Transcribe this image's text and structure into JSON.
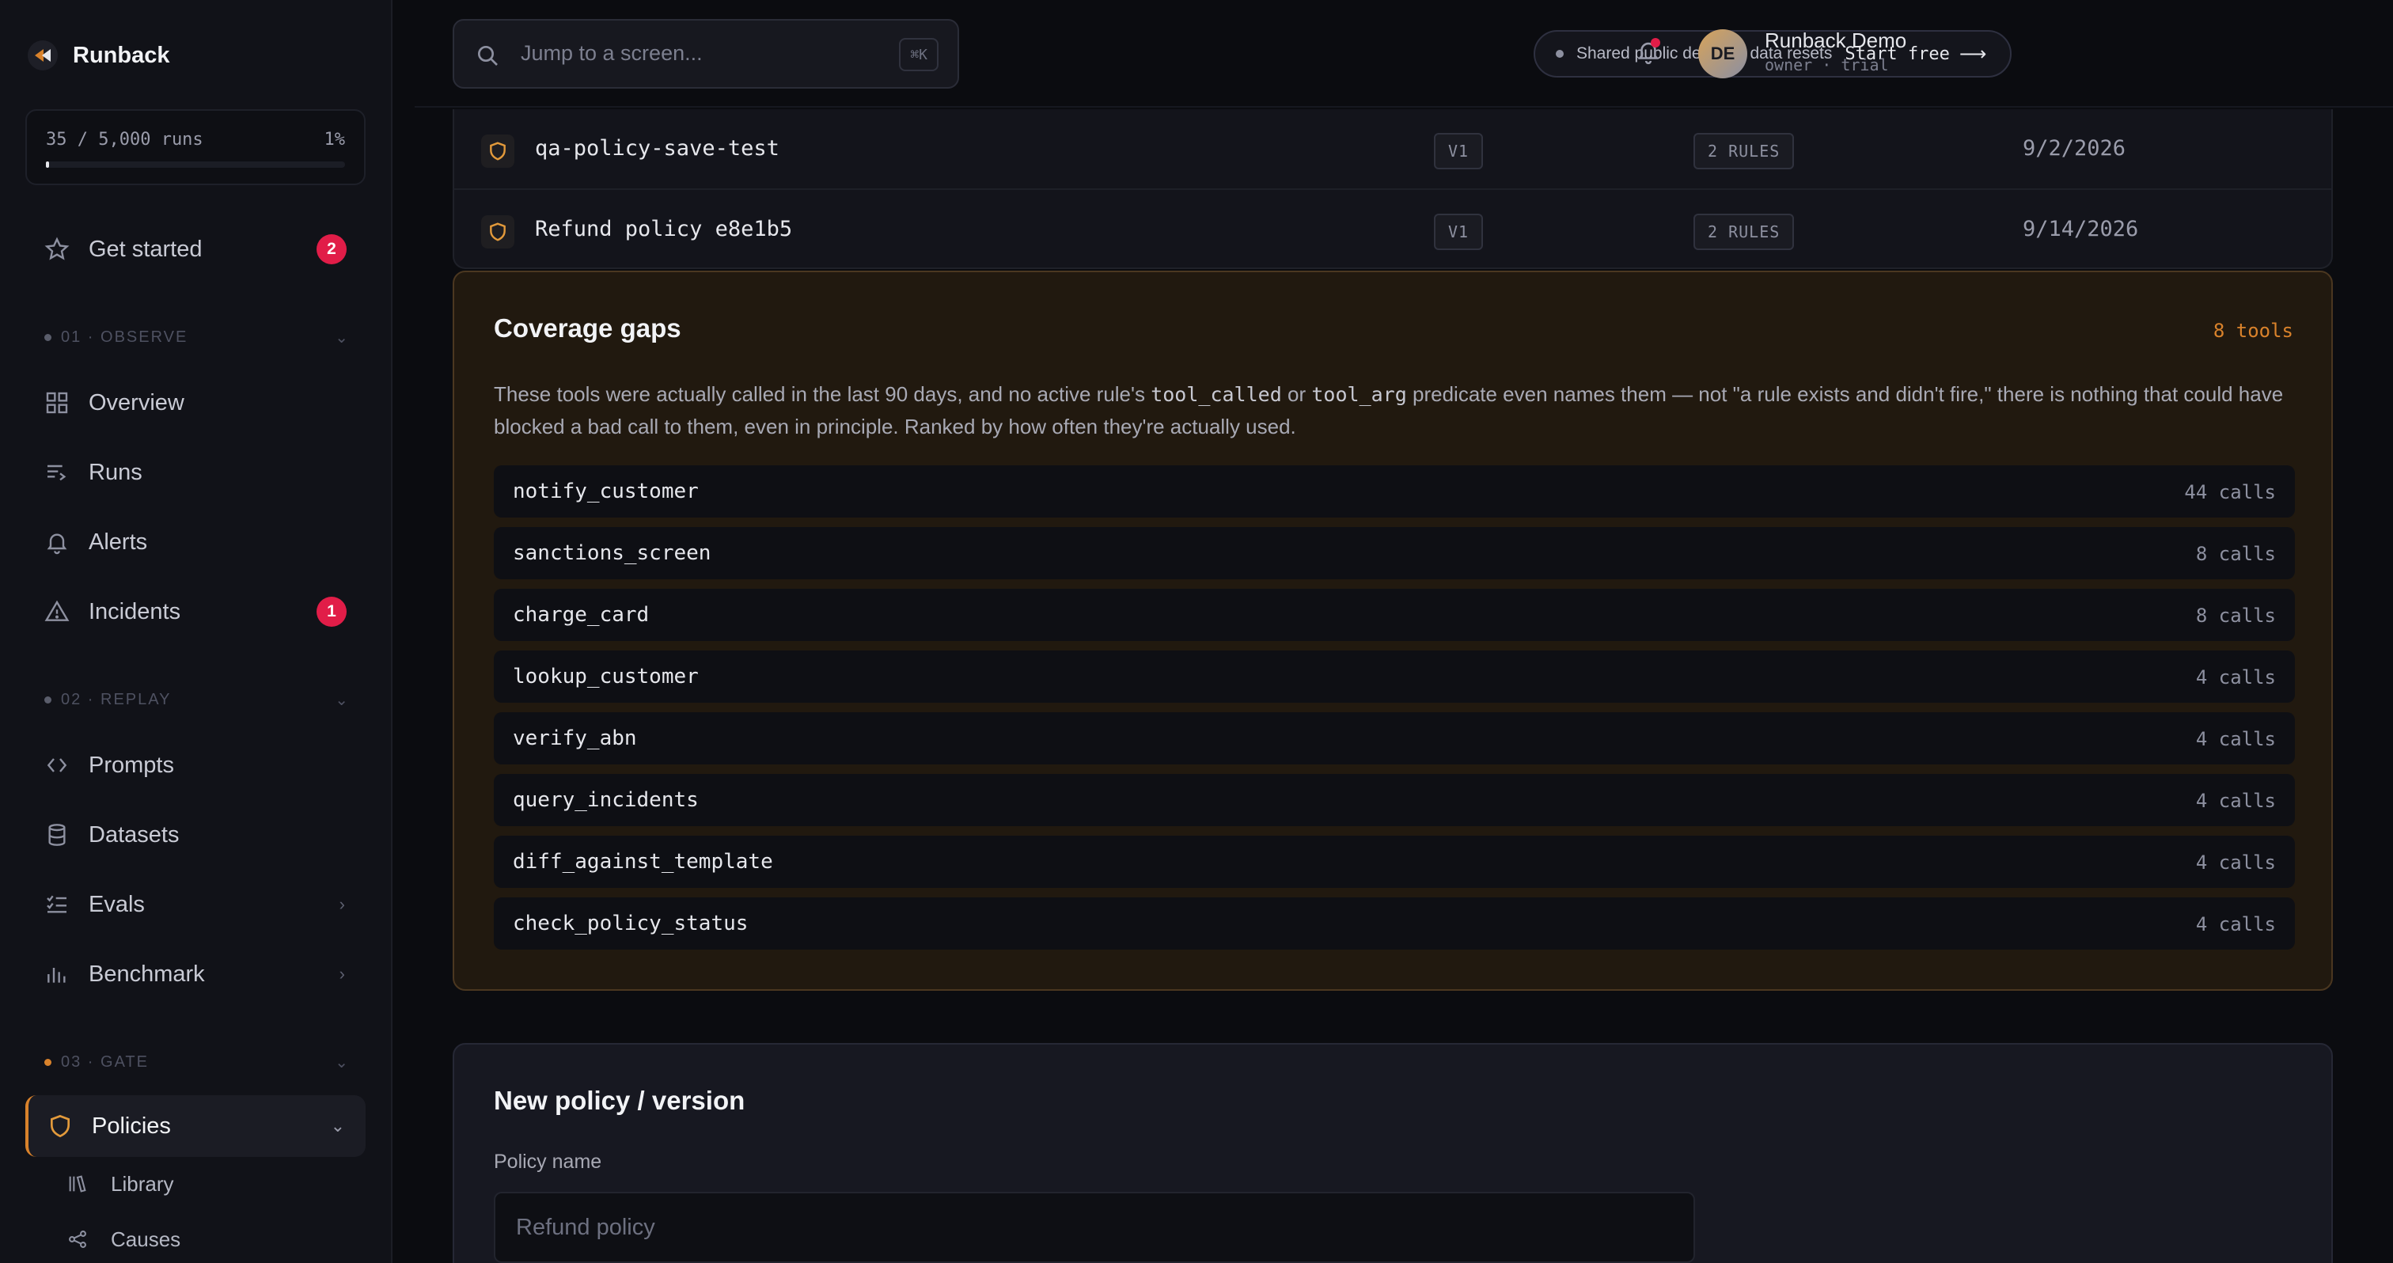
{
  "brand": {
    "name": "Runback"
  },
  "usage": {
    "text": "35 / 5,000 runs",
    "percent_label": "1%",
    "fraction": 0.01
  },
  "nav": {
    "get_started": {
      "label": "Get started",
      "badge": "2"
    },
    "observe_header": "01 · OBSERVE",
    "overview": "Overview",
    "runs": "Runs",
    "alerts": "Alerts",
    "incidents": {
      "label": "Incidents",
      "badge": "1"
    },
    "replay_header": "02 · REPLAY",
    "prompts": "Prompts",
    "datasets": "Datasets",
    "evals": "Evals",
    "benchmark": "Benchmark",
    "gate_header": "03 · GATE",
    "policies": "Policies",
    "library": "Library",
    "causes": "Causes"
  },
  "topbar": {
    "search_placeholder": "Jump to a screen...",
    "search_shortcut": "⌘K",
    "demo_message": "Shared public demo — data resets",
    "demo_cta": "Start free",
    "demo_arrow": "⟶",
    "user_initials": "DE",
    "user_name": "Runback Demo",
    "user_role": "owner · trial"
  },
  "policies": [
    {
      "name": "qa-policy-save-test",
      "version": "V1",
      "rules": "2 RULES",
      "date": "9/2/2026"
    },
    {
      "name": "Refund policy e8e1b5",
      "version": "V1",
      "rules": "2 RULES",
      "date": "9/14/2026"
    }
  ],
  "coverage_gaps": {
    "title": "Coverage gaps",
    "count": "8 tools",
    "desc_1": "These tools were actually called in the last 90 days, and no active rule's ",
    "code_1": "tool_called",
    "desc_2": " or ",
    "code_2": "tool_arg",
    "desc_3": " predicate even names them — not \"a rule exists and didn't fire,\" there is nothing that could have blocked a bad call to them, even in principle. Ranked by how often they're actually used.",
    "tools": [
      {
        "name": "notify_customer",
        "calls": "44 calls"
      },
      {
        "name": "sanctions_screen",
        "calls": "8 calls"
      },
      {
        "name": "charge_card",
        "calls": "8 calls"
      },
      {
        "name": "lookup_customer",
        "calls": "4 calls"
      },
      {
        "name": "verify_abn",
        "calls": "4 calls"
      },
      {
        "name": "query_incidents",
        "calls": "4 calls"
      },
      {
        "name": "diff_against_template",
        "calls": "4 calls"
      },
      {
        "name": "check_policy_status",
        "calls": "4 calls"
      }
    ]
  },
  "new_policy": {
    "title": "New policy / version",
    "name_label": "Policy name",
    "name_placeholder": "Refund policy"
  },
  "colors": {
    "accent": "#d9822b",
    "badge": "#e11d48",
    "gaps_bg": "#21190f"
  }
}
